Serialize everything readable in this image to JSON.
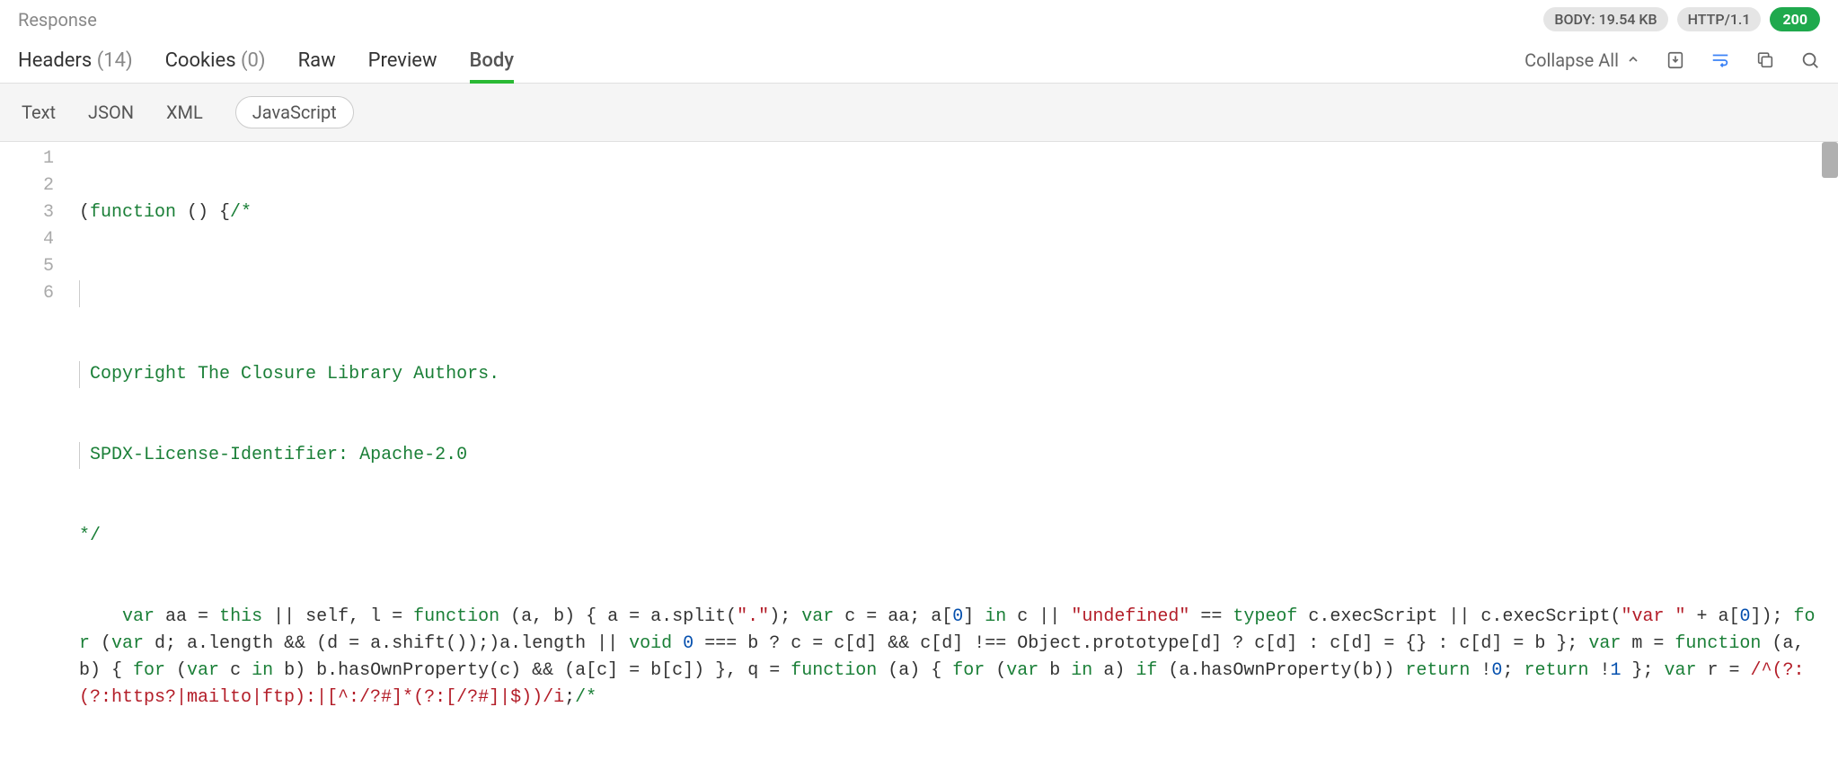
{
  "section_title": "Response",
  "status": {
    "body_size": "BODY: 19.54 KB",
    "protocol": "HTTP/1.1",
    "code": "200"
  },
  "tabs": {
    "headers": {
      "label": "Headers",
      "count": "(14)"
    },
    "cookies": {
      "label": "Cookies",
      "count": "(0)"
    },
    "raw": "Raw",
    "preview": "Preview",
    "body": "Body"
  },
  "actions": {
    "collapse_all": "Collapse All"
  },
  "subtabs": {
    "text": "Text",
    "json": "JSON",
    "xml": "XML",
    "javascript": "JavaScript"
  },
  "gutter": [
    "1",
    "2",
    "3",
    "4",
    "5",
    "6"
  ],
  "code": {
    "l1": {
      "a": "(",
      "b": "function",
      "c": " () {",
      "d": "/*"
    },
    "l2": "",
    "l3": " Copyright The Closure Library Authors.",
    "l4": " SPDX-License-Identifier: Apache-2.0",
    "l5": "*/",
    "l6": {
      "indent": "    ",
      "kw_var1": "var",
      "sp": " ",
      "aa": "aa = ",
      "kw_this": "this",
      "mid1": " || self, l = ",
      "kw_fn1": "function",
      "args1": " (a, b) { a = a.split(",
      "str_dot": "\".\"",
      "close_split": "); ",
      "kw_var2": "var",
      "mid2": " c = aa; a[",
      "num0a": "0",
      "mid3": "] ",
      "kw_in1": "in",
      "mid4": " c || ",
      "str_undef": "\"undefined\"",
      "eq": " == ",
      "kw_typeof": "typeof",
      "tail1": " c.execScript || ",
      "wrap2_a": "c.execScript(",
      "str_var": "\"var \"",
      "wrap2_b": " + a[",
      "num0b": "0",
      "wrap2_c": "]); ",
      "kw_for1": "for",
      "wrap2_d": " (",
      "kw_var3": "var",
      "wrap2_e": " d; a.length && (d = a.shift());)a.length || ",
      "kw_void": "void",
      "sp2": " ",
      "num0c": "0",
      "wrap2_f": " === b ? c = c[d] && c[d] !== Object.",
      "wrap3_a": "prototype[d] ? c[d] : c[d] = {} : c[d] = b }; ",
      "kw_var4": "var",
      "wrap3_b": " m = ",
      "kw_fn2": "function",
      "wrap3_c": " (a, b) { ",
      "kw_for2": "for",
      "wrap3_d": " (",
      "kw_var5": "var",
      "wrap3_e": " c ",
      "kw_in2": "in",
      "wrap3_f": " b) b.hasOwnProperty(c) && (a[c] = b[c]) }, ",
      "wrap4_a": "q = ",
      "kw_fn3": "function",
      "wrap4_b": " (a) { ",
      "kw_for3": "for",
      "wrap4_c": " (",
      "kw_var6": "var",
      "wrap4_d": " b ",
      "kw_in3": "in",
      "wrap4_e": " a) ",
      "kw_if": "if",
      "wrap4_f": " (a.hasOwnProperty(b)) ",
      "kw_ret1": "return",
      "wrap4_g": " !",
      "num0d": "0",
      "wrap4_h": "; ",
      "kw_ret2": "return",
      "wrap4_i": " !",
      "num1": "1",
      "wrap4_j": " }; ",
      "kw_var7": "var",
      "wrap4_k": " r = ",
      "regex": "/^(?:(?:https?|mailto|ftp):|[^:/?#]*",
      "wrap5_a": "(?:[/?#]|$))/i",
      "wrap5_b": ";",
      "cmt_tail": "/*"
    }
  }
}
